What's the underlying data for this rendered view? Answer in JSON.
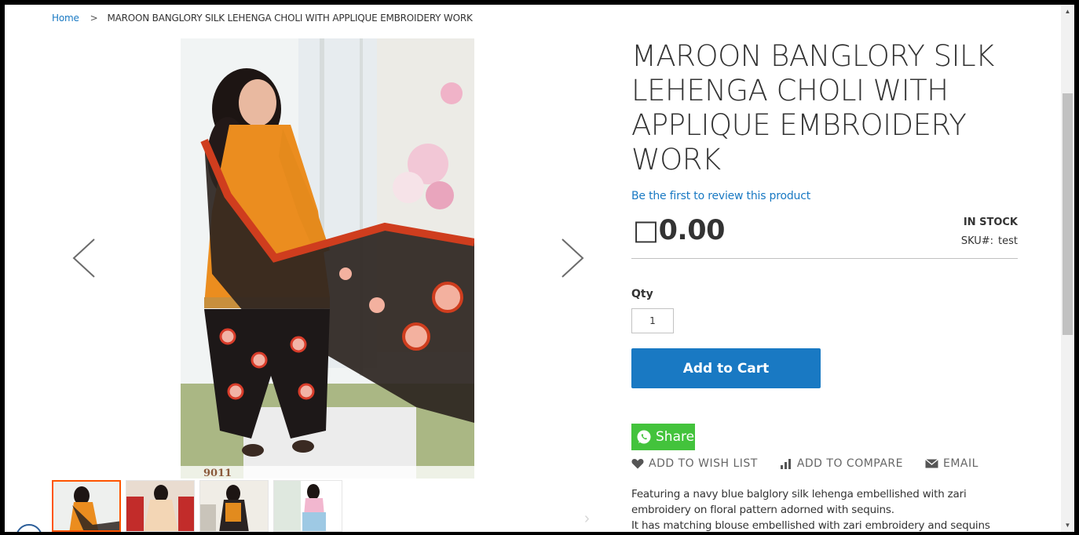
{
  "breadcrumb": {
    "home": "Home",
    "separator": ">",
    "current": "MAROON BANGLORY SILK LEHENGA CHOLI WITH APPLIQUE EMBROIDERY WORK"
  },
  "gallery": {
    "image_caption": "9011",
    "thumbnail_count": 4,
    "active_thumbnail": 1
  },
  "product": {
    "title": "MAROON BANGLORY SILK LEHENGA CHOLI WITH APPLIQUE EMBROIDERY WORK",
    "review_link": "Be the first to review this product",
    "price": "□0.00",
    "stock": "IN STOCK",
    "sku_label": "SKU#:",
    "sku_value": "test",
    "qty_label": "Qty",
    "qty_value": "1",
    "add_to_cart": "Add to Cart",
    "share": "Share",
    "actions": {
      "wishlist": "ADD TO WISH LIST",
      "compare": "ADD TO COMPARE",
      "email": "EMAIL"
    },
    "description_lines": [
      "Featuring a navy blue balglory silk lehenga embellished with zari",
      "embroidery on floral pattern adorned with sequins.",
      "It has matching blouse embellished with zari embroidery and sequins work"
    ]
  },
  "colors": {
    "link": "#1979c3",
    "primary_button": "#1979c3",
    "share_green": "#43c33c",
    "active_thumb_border": "#ff5501"
  }
}
